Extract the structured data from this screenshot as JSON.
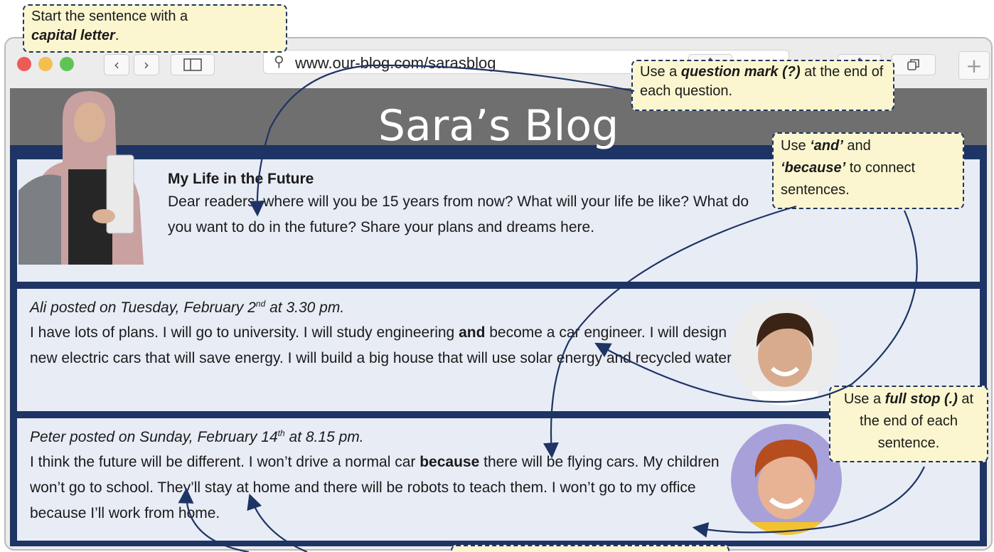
{
  "browser": {
    "url": "www.our-blog.com/sarasblog",
    "nav_back": "‹",
    "nav_forward": "›",
    "new_tab": "+"
  },
  "site": {
    "title": "Sara’s Blog"
  },
  "intro_post": {
    "title": "My Life in the Future",
    "body": "Dear readers, where will you be 15 years from now? What will your life be like? What do you want to do in the future? Share your plans and dreams here."
  },
  "comments": [
    {
      "author_prefix": "Ali posted on Tuesday, February 2",
      "author_sup": "nd",
      "author_suffix": " at 3.30 pm.",
      "body_before": "I have lots of plans. I will go to university. I will study engineering ",
      "body_bold": "and",
      "body_after": " become a car engineer. I will design new electric cars that will save energy. I will build a big house that will use solar energy and recycled water."
    },
    {
      "author_prefix": "Peter posted on Sunday, February 14",
      "author_sup": "th",
      "author_suffix": " at 8.15 pm.",
      "body_before": "I think the future will be different. I won’t drive a normal car ",
      "body_bold": "because",
      "body_after": " there will be flying cars. My children won’t go to school. They’ll stay at home and there will be robots to teach them. I won’t go to my office because I’ll work from home."
    }
  ],
  "notes": {
    "capital": {
      "text": "Start the sentence with a ",
      "bold": "capital letter",
      "end": "."
    },
    "question": {
      "text": "Use a ",
      "bold": "question mark (?)",
      "end": " at the end of each question."
    },
    "and_because": {
      "bold1": "‘and’",
      "mid": " and ",
      "bold2": "‘because’",
      "end": " to connect sentences.",
      "start": "Use "
    },
    "fullstop": {
      "text": "Use a ",
      "bold": "full stop (.)",
      "end": " at the end of each sentence."
    }
  },
  "colors": {
    "accent": "#1e3464",
    "note_bg": "#fbf6cf",
    "header_grey": "#6f6f6f",
    "panel_bg": "#e8ecf5"
  }
}
